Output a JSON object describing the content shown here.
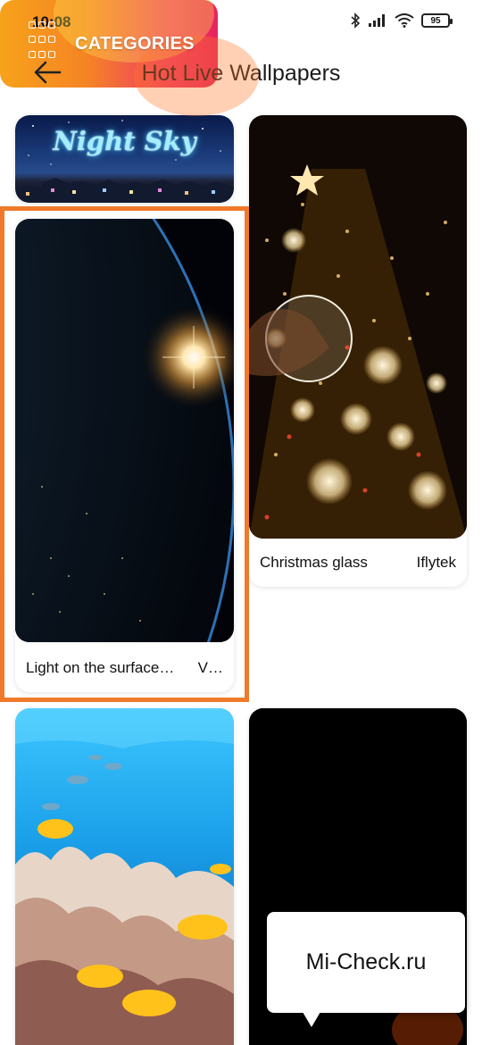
{
  "status": {
    "time": "10:08",
    "battery": "95",
    "icons": [
      "bluetooth-icon",
      "signal-icon",
      "wifi-icon",
      "battery-icon"
    ]
  },
  "header": {
    "title": "Hot Live Wallpapers",
    "back_icon": "arrow-left-icon"
  },
  "wallpapers": [
    {
      "title": "Night Sky"
    },
    {
      "caption": "Light on the surface…",
      "author": "V…"
    },
    {
      "caption": "Christmas glass",
      "author": "Iflytek"
    },
    {
      "banner": "CATEGORIES"
    }
  ],
  "watermark": "Mi-Check.ru",
  "colors": {
    "highlight": "#f07a2a",
    "categories_start": "#f7a21b",
    "categories_end": "#e8235e"
  }
}
